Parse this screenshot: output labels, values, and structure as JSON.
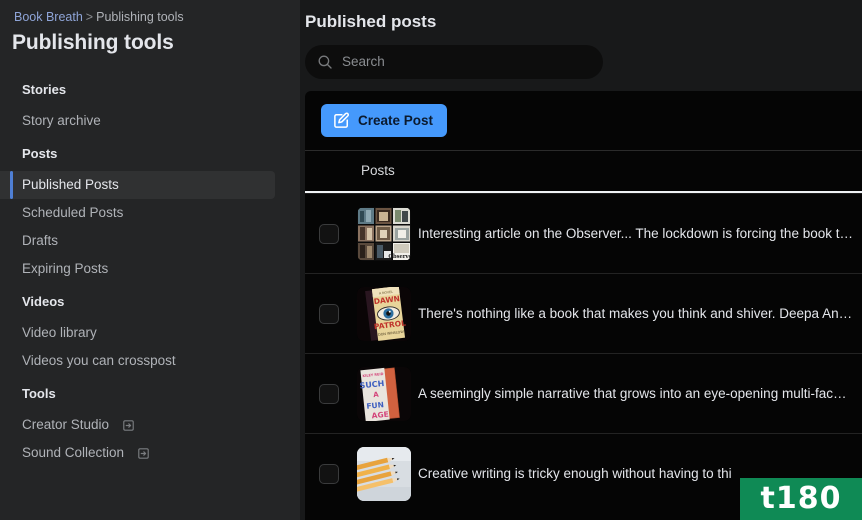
{
  "breadcrumb": {
    "link": "Book Breath",
    "separator": ">",
    "current": "Publishing tools"
  },
  "sidebar": {
    "title": "Publishing tools",
    "sections": [
      {
        "label": "Stories",
        "items": [
          {
            "label": "Story archive",
            "active": false,
            "external": false
          }
        ]
      },
      {
        "label": "Posts",
        "items": [
          {
            "label": "Published Posts",
            "active": true,
            "external": false
          },
          {
            "label": "Scheduled Posts",
            "active": false,
            "external": false
          },
          {
            "label": "Drafts",
            "active": false,
            "external": false
          },
          {
            "label": "Expiring Posts",
            "active": false,
            "external": false
          }
        ]
      },
      {
        "label": "Videos",
        "items": [
          {
            "label": "Video library",
            "active": false,
            "external": false
          },
          {
            "label": "Videos you can crosspost",
            "active": false,
            "external": false
          }
        ]
      },
      {
        "label": "Tools",
        "items": [
          {
            "label": "Creator Studio",
            "active": false,
            "external": true
          },
          {
            "label": "Sound Collection",
            "active": false,
            "external": true
          }
        ]
      }
    ]
  },
  "main": {
    "title": "Published posts",
    "search": {
      "placeholder": "Search",
      "value": ""
    },
    "create_button": {
      "label": "Create Post"
    },
    "tabs": [
      {
        "label": "Posts",
        "active": true
      }
    ],
    "rows": [
      {
        "text": "Interesting article on the Observer... The lockdown is forcing the book t…",
        "thumb": "bookshelf-collage"
      },
      {
        "text": "There's nothing like a book that makes you think and shiver. Deepa An…",
        "thumb": "dawn-patrol-cover"
      },
      {
        "text": "A seemingly simple narrative that grows into an eye-opening multi-fac…",
        "thumb": "such-a-fun-age-cover"
      },
      {
        "text": "Creative writing is tricky enough without having to thi",
        "thumb": "pencils-photo"
      }
    ]
  },
  "watermark": {
    "text": "t180",
    "color": "#0f8a55"
  },
  "colors": {
    "accent_blue": "#4599fc",
    "breadcrumb_link": "#8fa5d8",
    "active_marker": "#4f7fd4",
    "sidebar_bg": "#242526",
    "main_bg": "#18191a",
    "card_bg": "#050505"
  }
}
